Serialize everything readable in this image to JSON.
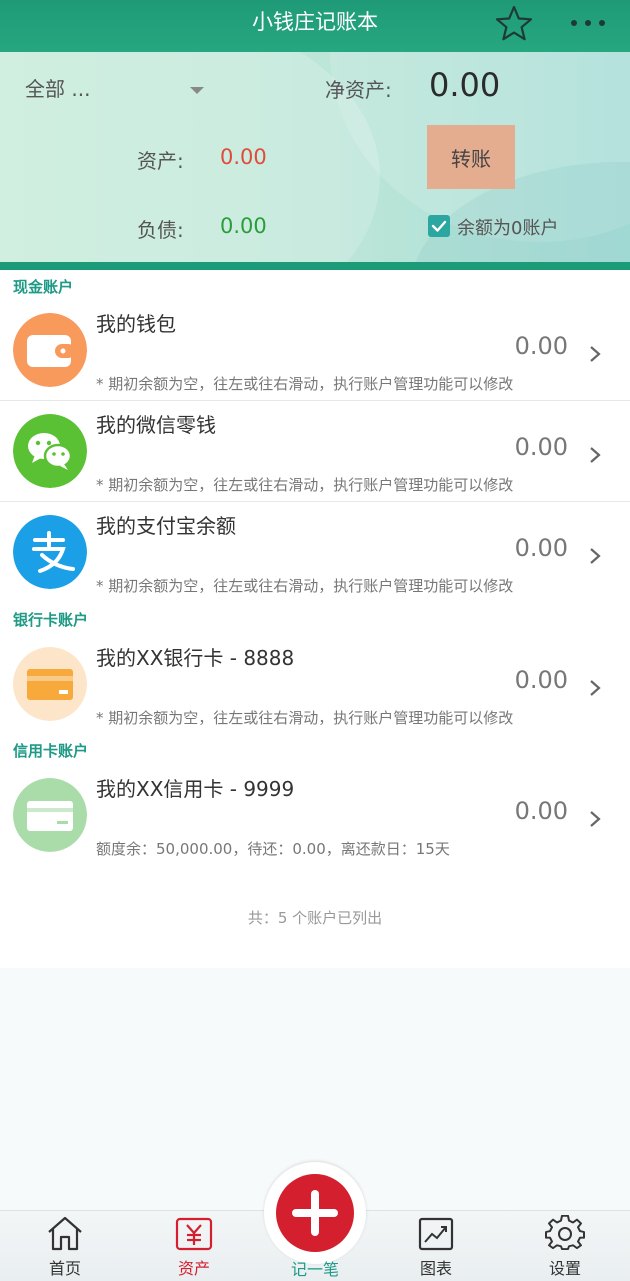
{
  "header": {
    "title": "小钱庄记账本",
    "icons": [
      "star-icon",
      "more-icon"
    ]
  },
  "summary": {
    "filter_label": "全部 ...",
    "net_assets_label": "净资产:",
    "net_assets_value": "0.00",
    "assets_label": "资产:",
    "assets_value": "0.00",
    "liabilities_label": "负债:",
    "liabilities_value": "0.00",
    "transfer_button": "转账",
    "zero_balance_label": "余额为0账户",
    "zero_balance_checked": true
  },
  "sections": {
    "cash": "现金账户",
    "bank": "银行卡账户",
    "credit": "信用卡账户"
  },
  "accounts": [
    {
      "name": "我的钱包",
      "amount": "0.00",
      "note": "* 期初余额为空，往左或往右滑动，执行账户管理功能可以修改",
      "icon": "wallet-icon",
      "color": "#f79a5c"
    },
    {
      "name": "我的微信零钱",
      "amount": "0.00",
      "note": "* 期初余额为空，往左或往右滑动，执行账户管理功能可以修改",
      "icon": "wechat-icon",
      "color": "#5bc134"
    },
    {
      "name": "我的支付宝余额",
      "amount": "0.00",
      "note": "* 期初余额为空，往左或往右滑动，执行账户管理功能可以修改",
      "icon": "alipay-icon",
      "color": "#1ba0e8"
    },
    {
      "name": "我的XX银行卡 - 8888",
      "amount": "0.00",
      "note": "* 期初余额为空，往左或往右滑动，执行账户管理功能可以修改",
      "icon": "bank-card-icon",
      "color": "#fde5c9"
    },
    {
      "name": "我的XX信用卡 - 9999",
      "amount": "0.00",
      "note": "额度余：50,000.00，待还：0.00，离还款日：15天",
      "icon": "credit-card-icon",
      "color": "#a9dca8"
    }
  ],
  "list_footer": "共：5 个账户已列出",
  "tabbar": {
    "home": "首页",
    "assets": "资产",
    "add": "记一笔",
    "charts": "图表",
    "settings": "设置",
    "active": "assets"
  },
  "colors": {
    "primary_green": "#1f9a78",
    "accent_red": "#d31f2e",
    "transfer_button": "#e5ad90",
    "positive_green": "#2a9d3a",
    "negative_red": "#e04b3b"
  }
}
